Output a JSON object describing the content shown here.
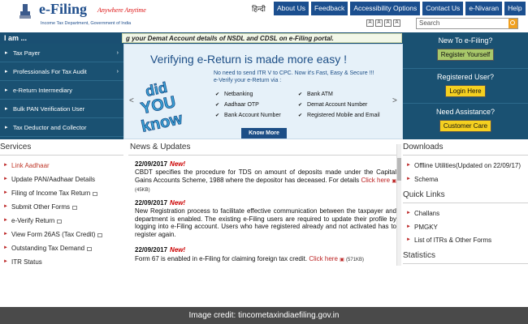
{
  "header": {
    "logo_text": "e-Filing",
    "logo_tagline": "Anywhere Anytime",
    "logo_sub": "Income Tax Department, Government of India",
    "lang": "हिन्दी",
    "nav": [
      "About Us",
      "Feedback",
      "Accessibility Options",
      "Contact Us",
      "e-Nivaran",
      "Help"
    ],
    "font_sizes": [
      "A",
      "A",
      "A",
      "A"
    ],
    "search_placeholder": "Search"
  },
  "iam": {
    "label": "I am ..."
  },
  "ticker": "g your Demat Account details of NSDL and CDSL on e-Filing portal.",
  "sidebar": [
    {
      "label": "Tax Payer",
      "arrow": "›"
    },
    {
      "label": "Professionals For Tax Audit",
      "arrow": "›"
    },
    {
      "label": "e-Return Intermediary",
      "arrow": ""
    },
    {
      "label": "Bulk PAN Verification User",
      "arrow": ""
    },
    {
      "label": "Tax Deductor and Collector",
      "arrow": ""
    }
  ],
  "banner": {
    "title": "Verifying e-Return is made more easy !",
    "sub1": "No need to send ITR V to CPC. Now it's Fast, Easy & Secure !!!",
    "sub2": "e-Verify your e-Return via :",
    "didyou": [
      "did",
      "YOU",
      "know"
    ],
    "options_left": [
      "Netbanking",
      "Aadhaar OTP",
      "Bank Account Number"
    ],
    "options_right": [
      "Bank ATM",
      "Demat Account Number",
      "Registered Mobile and Email"
    ],
    "button": "Know More",
    "prev": "<",
    "next": ">"
  },
  "right_boxes": [
    {
      "title": "New To e-Filing?",
      "button": "Register Yourself",
      "color": "#a8c86a"
    },
    {
      "title": "Registered User?",
      "button": "Login Here",
      "color": "#f5d020"
    },
    {
      "title": "Need Assistance?",
      "button": "Customer Care",
      "color": "#f5d020"
    }
  ],
  "services": {
    "title": "Services",
    "items": [
      {
        "label": "Link Aadhaar",
        "lock": false
      },
      {
        "label": "Update PAN/Aadhaar Details",
        "lock": false
      },
      {
        "label": "Filing of Income Tax Return",
        "lock": true
      },
      {
        "label": "Submit Other Forms",
        "lock": true
      },
      {
        "label": "e-Verify Return",
        "lock": true
      },
      {
        "label": "View Form 26AS (Tax Credit)",
        "lock": true
      },
      {
        "label": "Outstanding Tax Demand",
        "lock": true
      },
      {
        "label": "ITR Status",
        "lock": false
      }
    ]
  },
  "news": {
    "title": "News & Updates",
    "items": [
      {
        "date": "22/09/2017",
        "new": "New!",
        "text": "CBDT specifies the procedure for TDS on amount of deposits made under the Capital Gains Accounts Scheme, 1988 where the depositor has deceased. For details",
        "link": "Click here",
        "size": "(45KB)"
      },
      {
        "date": "22/09/2017",
        "new": "New!",
        "text": "New Registration process to facilitate effective communication between the taxpayer and department is enabled. The existing e-Filing users are required to update their profile by logging into e-Filing account. Users who have registered already and not activated has to register again.",
        "link": "",
        "size": ""
      },
      {
        "date": "22/09/2017",
        "new": "New!",
        "text": "Form 67 is enabled in e-Filing for claiming foreign tax credit.",
        "link": "Click here",
        "size": "(571KB)"
      }
    ]
  },
  "downloads": {
    "title": "Downloads",
    "items": [
      "Offline Utilities(Updated on 22/09/17)",
      "Schema"
    ]
  },
  "quicklinks": {
    "title": "Quick Links",
    "items": [
      "Challans",
      "PMGKY",
      "List of ITRs & Other Forms"
    ]
  },
  "statistics": {
    "title": "Statistics"
  },
  "credit": "Image credit: tincometaxindiaefiling.gov.in",
  "colors": {
    "navy": "#1b4f8f",
    "teal": "#1a5172",
    "red": "#c0392b"
  }
}
